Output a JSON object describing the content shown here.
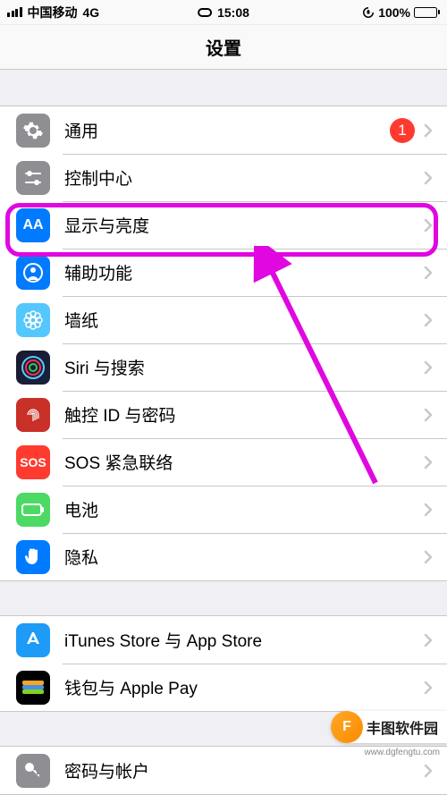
{
  "status_bar": {
    "carrier": "中国移动",
    "network": "4G",
    "time": "15:08",
    "battery_pct": "100%"
  },
  "nav": {
    "title": "设置"
  },
  "groups": [
    {
      "rows": [
        {
          "id": "general",
          "label": "通用",
          "icon": "gear",
          "icon_bg": "bg-gray",
          "badge": "1"
        },
        {
          "id": "control-center",
          "label": "控制中心",
          "icon": "sliders",
          "icon_bg": "bg-gray"
        },
        {
          "id": "display",
          "label": "显示与亮度",
          "icon": "aa",
          "icon_bg": "bg-blue",
          "highlight": true
        },
        {
          "id": "accessibility",
          "label": "辅助功能",
          "icon": "person",
          "icon_bg": "bg-blue"
        },
        {
          "id": "wallpaper",
          "label": "墙纸",
          "icon": "flower",
          "icon_bg": "bg-cyan"
        },
        {
          "id": "siri",
          "label": "Siri 与搜索",
          "icon": "siri",
          "icon_bg": "bg-gradient"
        },
        {
          "id": "touchid",
          "label": "触控 ID 与密码",
          "icon": "fingerprint",
          "icon_bg": "bg-darkred"
        },
        {
          "id": "sos",
          "label": "SOS 紧急联络",
          "icon": "sos",
          "icon_bg": "bg-red"
        },
        {
          "id": "battery",
          "label": "电池",
          "icon": "battery",
          "icon_bg": "bg-green"
        },
        {
          "id": "privacy",
          "label": "隐私",
          "icon": "hand",
          "icon_bg": "bg-blue"
        }
      ]
    },
    {
      "rows": [
        {
          "id": "itunes",
          "label": "iTunes Store 与 App Store",
          "icon": "appstore",
          "icon_bg": "bg-blue2"
        },
        {
          "id": "wallet",
          "label": "钱包与 Apple Pay",
          "icon": "wallet",
          "icon_bg": "bg-black"
        }
      ]
    },
    {
      "rows": [
        {
          "id": "accounts",
          "label": "密码与帐户",
          "icon": "key",
          "icon_bg": "bg-gray"
        }
      ]
    }
  ],
  "annotations": {
    "highlight_color": "#E007E0",
    "arrow_color": "#E007E0"
  },
  "watermark": {
    "logo_letter": "F",
    "text": "丰图软件园",
    "url": "www.dgfengtu.com"
  }
}
